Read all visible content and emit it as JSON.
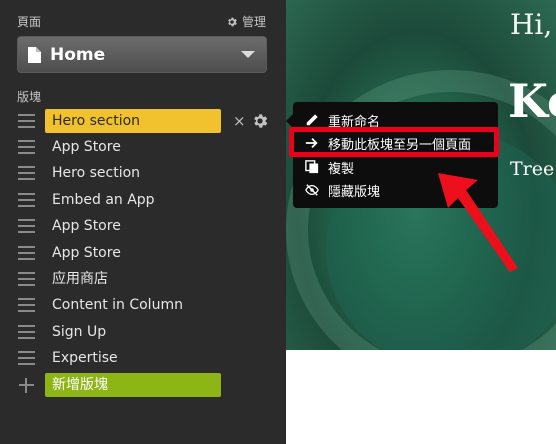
{
  "sidebar": {
    "pages_label": "頁面",
    "manage_label": "管理",
    "selected_page": "Home",
    "blocks_label": "版塊",
    "blocks": [
      {
        "label": "Hero section",
        "active": true
      },
      {
        "label": "App Store"
      },
      {
        "label": "Hero section"
      },
      {
        "label": "Embed an App"
      },
      {
        "label": "App Store"
      },
      {
        "label": "App Store"
      },
      {
        "label": "应用商店"
      },
      {
        "label": "Content in Column"
      },
      {
        "label": "Sign Up"
      },
      {
        "label": "Expertise"
      }
    ],
    "add_block_label": "新增版塊",
    "close_symbol": "×"
  },
  "context_menu": {
    "items": [
      {
        "label": "重新命名",
        "icon": "pencil-icon"
      },
      {
        "label": "移動此板塊至另一個頁面",
        "icon": "arrow-right-icon",
        "highlighted": true
      },
      {
        "label": "複製",
        "icon": "copy-icon"
      },
      {
        "label": "隱藏版塊",
        "icon": "eye-slash-icon"
      }
    ]
  },
  "hero": {
    "greeting": "Hi,",
    "title": "Ko",
    "subtitle": "Tree"
  },
  "colors": {
    "panel_bg": "#2b2b2b",
    "active_block": "#f2c12e",
    "add_block": "#8db516",
    "highlight_red": "#e8001c",
    "menu_bg": "#0d0d0d"
  }
}
